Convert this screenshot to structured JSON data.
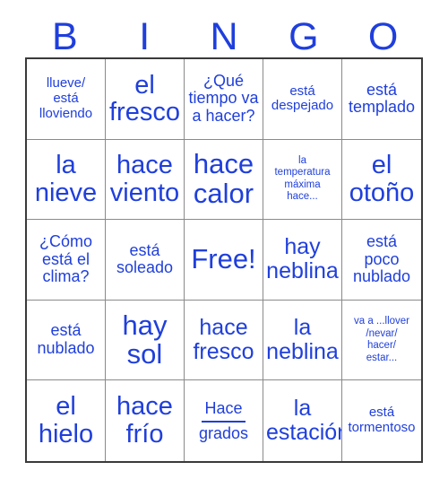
{
  "card": {
    "title_letters": [
      "B",
      "I",
      "N",
      "G",
      "O"
    ],
    "accent_color": "#1f3fdc",
    "border_color": "#3a3a3a",
    "grid_line_color": "#8a8a8a",
    "background": "#ffffff",
    "rows": 5,
    "columns": 5,
    "cells": [
      {
        "text": "llueve/\nestá\nlloviendo",
        "size": "s",
        "column": "B",
        "row": 1
      },
      {
        "text": "el\nfresco",
        "size": "xl",
        "column": "I",
        "row": 1
      },
      {
        "text": "¿Qué\ntiempo va\na hacer?",
        "size": "m",
        "column": "N",
        "row": 1
      },
      {
        "text": "está\ndespejado",
        "size": "s",
        "column": "G",
        "row": 1
      },
      {
        "text": "está\ntemplado",
        "size": "m",
        "column": "O",
        "row": 1
      },
      {
        "text": "la\nnieve",
        "size": "xl",
        "column": "B",
        "row": 2
      },
      {
        "text": "hace\nviento",
        "size": "xl",
        "column": "I",
        "row": 2
      },
      {
        "text": "hace\ncalor",
        "size": "xxl",
        "column": "N",
        "row": 2
      },
      {
        "text": "la\ntemperatura\nmáxima\nhace...",
        "size": "xs",
        "column": "G",
        "row": 2
      },
      {
        "text": "el\notoño",
        "size": "xl",
        "column": "O",
        "row": 2
      },
      {
        "text": "¿Cómo\nestá el\nclima?",
        "size": "m",
        "column": "B",
        "row": 3
      },
      {
        "text": "está\nsoleado",
        "size": "m",
        "column": "I",
        "row": 3
      },
      {
        "text": "Free!",
        "size": "xxl",
        "column": "N",
        "row": 3
      },
      {
        "text": "hay\nneblina",
        "size": "l",
        "column": "G",
        "row": 3
      },
      {
        "text": "está\npoco\nnublado",
        "size": "m",
        "column": "O",
        "row": 3
      },
      {
        "text": "está\nnublado",
        "size": "m",
        "column": "B",
        "row": 4
      },
      {
        "text": "hay\nsol",
        "size": "xxl",
        "column": "I",
        "row": 4
      },
      {
        "text": "hace\nfresco",
        "size": "l",
        "column": "N",
        "row": 4
      },
      {
        "text": "la\nneblina",
        "size": "l",
        "column": "G",
        "row": 4
      },
      {
        "text": "va a ...llover\n/nevar/\nhacer/\nestar...",
        "size": "xs",
        "column": "O",
        "row": 4
      },
      {
        "text": "el\nhielo",
        "size": "xl",
        "column": "B",
        "row": 5
      },
      {
        "text": "hace\nfrío",
        "size": "xl",
        "column": "I",
        "row": 5
      },
      {
        "text": "",
        "size": "m",
        "column": "N",
        "row": 5,
        "blank_line": true,
        "text_above": "Hace",
        "text_below": "grados"
      },
      {
        "text": "la\nestación",
        "size": "l",
        "column": "G",
        "row": 5
      },
      {
        "text": "está\ntormentoso",
        "size": "s",
        "column": "O",
        "row": 5
      }
    ]
  }
}
